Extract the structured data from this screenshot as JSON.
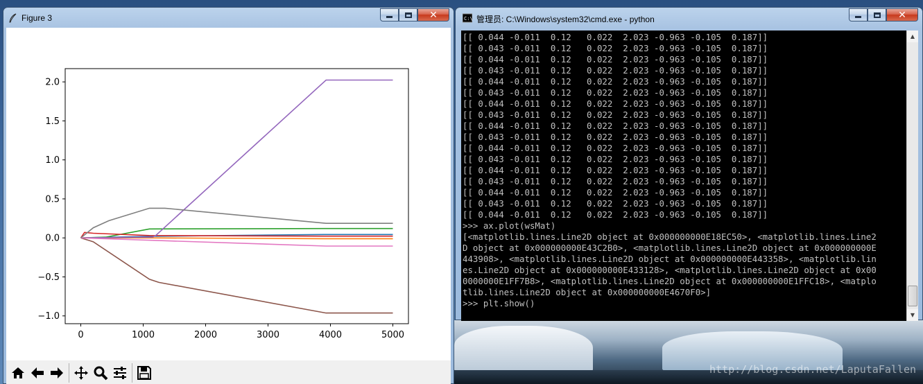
{
  "figure_window": {
    "title": "Figure 3",
    "toolbar": {
      "icons": [
        "home-icon",
        "back-icon",
        "forward-icon",
        "pan-icon",
        "zoom-icon",
        "configure-subplots-icon",
        "save-icon"
      ]
    }
  },
  "console_window": {
    "title": "管理员: C:\\Windows\\system32\\cmd.exe - python",
    "lines": [
      "[[ 0.044 -0.011  0.12   0.022  2.023 -0.963 -0.105  0.187]]",
      "[[ 0.043 -0.011  0.12   0.022  2.023 -0.963 -0.105  0.187]]",
      "[[ 0.044 -0.011  0.12   0.022  2.023 -0.963 -0.105  0.187]]",
      "[[ 0.043 -0.011  0.12   0.022  2.023 -0.963 -0.105  0.187]]",
      "[[ 0.044 -0.011  0.12   0.022  2.023 -0.963 -0.105  0.187]]",
      "[[ 0.043 -0.011  0.12   0.022  2.023 -0.963 -0.105  0.187]]",
      "[[ 0.044 -0.011  0.12   0.022  2.023 -0.963 -0.105  0.187]]",
      "[[ 0.043 -0.011  0.12   0.022  2.023 -0.963 -0.105  0.187]]",
      "[[ 0.044 -0.011  0.12   0.022  2.023 -0.963 -0.105  0.187]]",
      "[[ 0.043 -0.011  0.12   0.022  2.023 -0.963 -0.105  0.187]]",
      "[[ 0.044 -0.011  0.12   0.022  2.023 -0.963 -0.105  0.187]]",
      "[[ 0.043 -0.011  0.12   0.022  2.023 -0.963 -0.105  0.187]]",
      "[[ 0.044 -0.011  0.12   0.022  2.023 -0.963 -0.105  0.187]]",
      "[[ 0.043 -0.011  0.12   0.022  2.023 -0.963 -0.105  0.187]]",
      "[[ 0.044 -0.011  0.12   0.022  2.023 -0.963 -0.105  0.187]]",
      "[[ 0.043 -0.011  0.12   0.022  2.023 -0.963 -0.105  0.187]]",
      "[[ 0.044 -0.011  0.12   0.022  2.023 -0.963 -0.105  0.187]]",
      ">>> ax.plot(wsMat)",
      "[<matplotlib.lines.Line2D object at 0x000000000E18EC50>, <matplotlib.lines.Line2",
      "D object at 0x000000000E43C2B0>, <matplotlib.lines.Line2D object at 0x000000000E",
      "443908>, <matplotlib.lines.Line2D object at 0x000000000E443358>, <matplotlib.lin",
      "es.Line2D object at 0x000000000E433128>, <matplotlib.lines.Line2D object at 0x00",
      "0000000E1FF7B8>, <matplotlib.lines.Line2D object at 0x000000000E1FFC18>, <matplo",
      "tlib.lines.Line2D object at 0x000000000E4670F0>]",
      ">>> plt.show()"
    ]
  },
  "desktop": {
    "watermark": "http://blog.csdn.net/LaputaFallen"
  },
  "chart_data": {
    "type": "line",
    "title": "",
    "xlabel": "",
    "ylabel": "",
    "xlim": [
      -250,
      5250
    ],
    "ylim": [
      -1.1,
      2.17
    ],
    "xticks": [
      0,
      1000,
      2000,
      3000,
      4000,
      5000
    ],
    "xtick_labels": [
      "0",
      "1000",
      "2000",
      "3000",
      "4000",
      "5000"
    ],
    "yticks": [
      -1.0,
      -0.5,
      0.0,
      0.5,
      1.0,
      1.5,
      2.0
    ],
    "ytick_labels": [
      "−1.0",
      "−0.5",
      "0.0",
      "0.5",
      "1.0",
      "1.5",
      "2.0"
    ],
    "grid": false,
    "series": [
      {
        "color": "#1f77b4",
        "points": [
          [
            0,
            0
          ],
          [
            1100,
            0.02
          ],
          [
            3900,
            0.044
          ],
          [
            5000,
            0.044
          ]
        ]
      },
      {
        "color": "#ff7f0e",
        "points": [
          [
            0,
            0
          ],
          [
            1100,
            0.0
          ],
          [
            3900,
            -0.011
          ],
          [
            5000,
            -0.011
          ]
        ]
      },
      {
        "color": "#2ca02c",
        "points": [
          [
            0,
            0
          ],
          [
            400,
            0.01
          ],
          [
            1100,
            0.115
          ],
          [
            3900,
            0.12
          ],
          [
            5000,
            0.12
          ]
        ]
      },
      {
        "color": "#d62728",
        "points": [
          [
            0,
            0
          ],
          [
            60,
            0.07
          ],
          [
            200,
            0.06
          ],
          [
            1100,
            0.03
          ],
          [
            3900,
            0.022
          ],
          [
            5000,
            0.022
          ]
        ]
      },
      {
        "color": "#9467bd",
        "points": [
          [
            0,
            0
          ],
          [
            1150,
            0.01
          ],
          [
            1200,
            0.03
          ],
          [
            3930,
            2.023
          ],
          [
            5000,
            2.023
          ]
        ]
      },
      {
        "color": "#8c564b",
        "points": [
          [
            0,
            0
          ],
          [
            200,
            -0.05
          ],
          [
            1100,
            -0.53
          ],
          [
            1250,
            -0.57
          ],
          [
            3930,
            -0.963
          ],
          [
            5000,
            -0.963
          ]
        ]
      },
      {
        "color": "#e377c2",
        "points": [
          [
            0,
            0
          ],
          [
            1100,
            -0.03
          ],
          [
            3930,
            -0.105
          ],
          [
            5000,
            -0.105
          ]
        ]
      },
      {
        "color": "#7f7f7f",
        "points": [
          [
            0,
            0
          ],
          [
            200,
            0.13
          ],
          [
            450,
            0.22
          ],
          [
            1100,
            0.38
          ],
          [
            1350,
            0.38
          ],
          [
            3930,
            0.187
          ],
          [
            5000,
            0.187
          ]
        ]
      }
    ]
  }
}
